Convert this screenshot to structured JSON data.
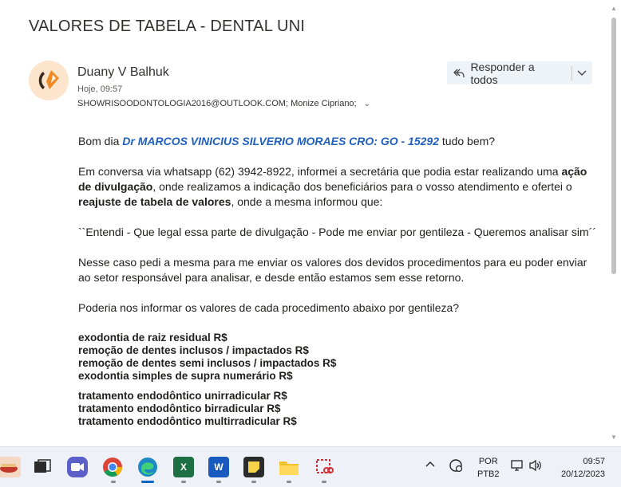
{
  "email": {
    "subject": "VALORES DE TABELA - DENTAL UNI",
    "sender": "Duany V Balhuk",
    "time": "Hoje, 09:57",
    "recipients": "SHOWRISOODONTOLOGIA2016@OUTLOOK.COM; Monize Cipriano;",
    "reply_all_label": "Responder a todos"
  },
  "body": {
    "greeting_pre": "Bom dia ",
    "greeting_name": "Dr MARCOS VINICIUS SILVERIO MORAES CRO: GO - 15292",
    "greeting_post": " tudo bem?",
    "p2_a": "Em conversa via whatsapp (62) 3942-8922, informei a secretária que podia estar realizando uma ",
    "p2_b": "ação de divulgação",
    "p2_c": ", onde realizamos a indicação dos beneficiários para o vosso atendimento e ofertei o ",
    "p2_d": "reajuste de tabela de valores",
    "p2_e": ", onde a mesma informou que:",
    "quote": "``Entendi  - Que legal essa parte de divulgação  - Pode me enviar por gentileza - Queremos analisar sim´´",
    "p4": "Nesse caso pedi a mesma para me enviar os valores dos devidos procedimentos para eu poder enviar ao setor responsável para analisar, e desde então estamos sem esse retorno.",
    "p5": "Poderia nos informar os valores de cada procedimento abaixo por gentileza?",
    "group1": [
      "exodontia de raiz residual  R$",
      "remoção de dentes inclusos / impactados R$",
      "remoção de dentes semi inclusos / impactados R$",
      "exodontia simples de supra numerário R$"
    ],
    "group2": [
      "tratamento endodôntico unirradicular R$",
      "tratamento endodôntico birradicular R$",
      "tratamento endodôntico multirradicular R$"
    ]
  },
  "taskbar": {
    "language_top": "POR",
    "language_bottom": "PTB2",
    "clock_time": "09:57",
    "clock_date": "20/12/2023"
  }
}
